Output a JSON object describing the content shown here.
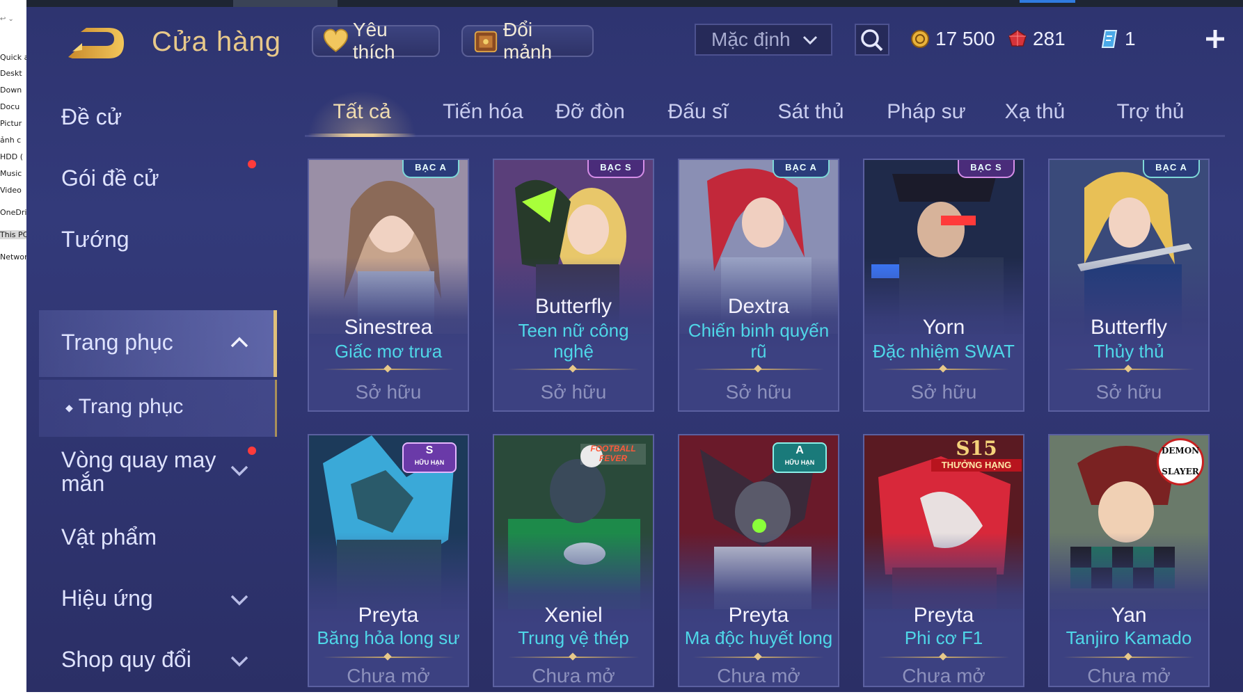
{
  "explorer": {
    "items": [
      "Quick a",
      "Deskt",
      "Down",
      "Docu",
      "Pictur",
      "ảnh c",
      "HDD (",
      "Music",
      "Video",
      "OneDri",
      "This PC",
      "Networ"
    ]
  },
  "header": {
    "title": "Cửa hàng",
    "favorites": "Yêu thích",
    "exchange": "Đổi mảnh",
    "sort_selected": "Mặc định",
    "gold": "17 500",
    "ruby": "281",
    "voucher": "1"
  },
  "sidebar": {
    "items": [
      {
        "label": "Đề cử"
      },
      {
        "label": "Gói đề cử"
      },
      {
        "label": "Tướng"
      },
      {
        "label": "Trang phục"
      },
      {
        "label": "Trang phục"
      },
      {
        "label": "Vòng quay may mắn"
      },
      {
        "label": "Vật phẩm"
      },
      {
        "label": "Hiệu ứng"
      },
      {
        "label": "Shop quy đổi"
      }
    ]
  },
  "tabs": [
    "Tất cả",
    "Tiến hóa",
    "Đỡ đòn",
    "Đấu sĩ",
    "Sát thủ",
    "Pháp sư",
    "Xạ thủ",
    "Trợ thủ"
  ],
  "cards": [
    {
      "hero": "Sinestrea",
      "skin": "Giấc mơ trưa",
      "badge": "BẠC A",
      "status": "Sở hữu"
    },
    {
      "hero": "Butterfly",
      "skin": "Teen nữ công nghệ",
      "badge": "BẠC S",
      "status": "Sở hữu"
    },
    {
      "hero": "Dextra",
      "skin": "Chiến binh quyến rũ",
      "badge": "BẠC A",
      "status": "Sở hữu"
    },
    {
      "hero": "Yorn",
      "skin": "Đặc nhiệm SWAT",
      "badge": "BẠC S",
      "status": "Sở hữu"
    },
    {
      "hero": "Butterfly",
      "skin": "Thủy thủ",
      "badge": "BẠC A",
      "status": "Sở hữu"
    },
    {
      "hero": "Preyta",
      "skin": "Băng hỏa long sư",
      "badge": "S",
      "badge_sub": "HỮU HẠN",
      "status": "Chưa mở"
    },
    {
      "hero": "Xeniel",
      "skin": "Trung vệ thép",
      "badge": "FOOTBALL FEVER",
      "status": "Chưa mở"
    },
    {
      "hero": "Preyta",
      "skin": "Ma độc huyết long",
      "badge": "A",
      "badge_sub": "HỮU HẠN",
      "status": "Chưa mở"
    },
    {
      "hero": "Preyta",
      "skin": "Phi cơ F1",
      "badge": "S15",
      "badge_sub": "THƯỞNG HẠNG",
      "status": "Chưa mở"
    },
    {
      "hero": "Yan",
      "skin": "Tanjiro Kamado",
      "badge": "DEMON SLAYER",
      "status": "Chưa mở"
    }
  ],
  "colors": {
    "background": "#2e3470",
    "accent_gold": "#e8c98a",
    "skin_name": "#4fd7e8",
    "notification": "#ff3b3b"
  }
}
